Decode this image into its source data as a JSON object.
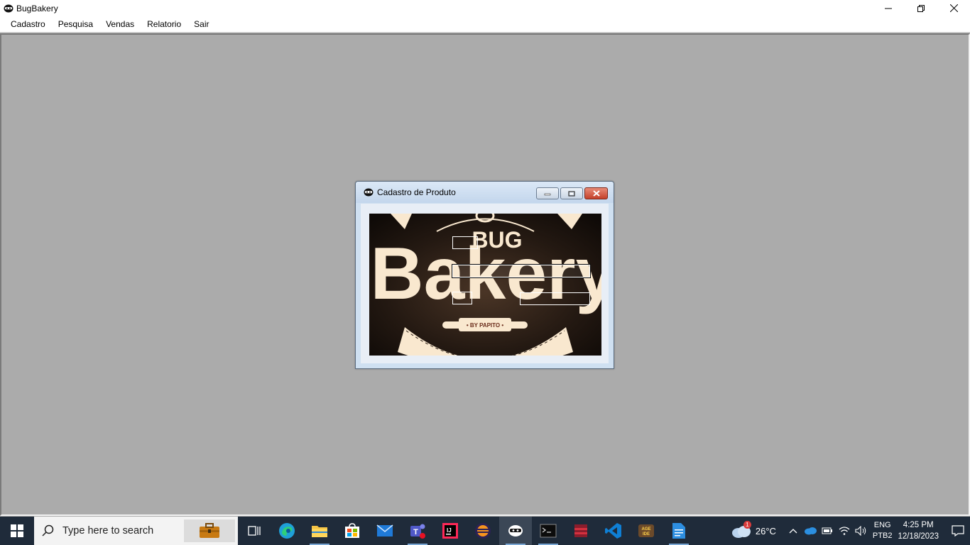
{
  "window": {
    "title": "BugBakery",
    "icon": "ninja-icon",
    "controls": {
      "minimize": "minimize-icon",
      "restore": "restore-icon",
      "close": "close-icon"
    }
  },
  "menu": {
    "items": [
      {
        "label": "Cadastro"
      },
      {
        "label": "Pesquisa"
      },
      {
        "label": "Vendas"
      },
      {
        "label": "Relatorio"
      },
      {
        "label": "Sair"
      }
    ]
  },
  "internal_frame": {
    "title": "Cadastro de Produto",
    "icon": "ninja-icon",
    "image": {
      "brand_top": "BUG",
      "brand_main": "Bakery",
      "byline": "• BY PAPITO •"
    }
  },
  "taskbar": {
    "search_placeholder": "Type here to search",
    "apps": [
      "task-view-icon",
      "edge-icon",
      "file-explorer-icon",
      "store-icon",
      "mail-icon",
      "teams-icon",
      "intellij-icon",
      "eclipse-icon",
      "java-app-icon",
      "terminal-icon",
      "winrar-icon",
      "vscode-icon",
      "aida-icon",
      "notepad-icon"
    ],
    "weather": {
      "temp": "26°C",
      "badge": "1"
    },
    "lang": {
      "top": "ENG",
      "bottom": "PTB2"
    },
    "clock": {
      "time": "4:25 PM",
      "date": "12/18/2023"
    }
  },
  "colors": {
    "desktop": "#ababab",
    "taskbar": "#1f2b3a",
    "frame_title": "#cfe0f1",
    "close_red": "#c4412a"
  }
}
